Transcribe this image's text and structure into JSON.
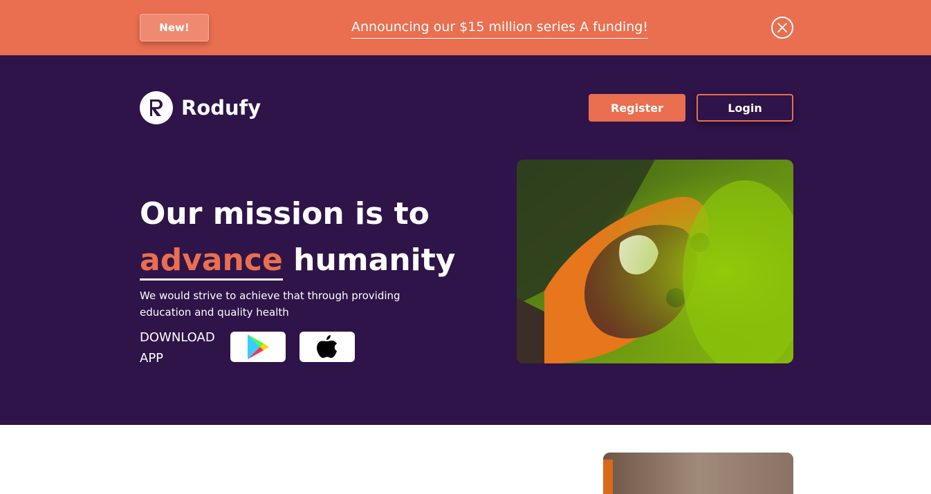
{
  "banner": {
    "badge_label": "New!",
    "announcement": "Announcing our $15 million series A funding!",
    "close_icon": "close-icon"
  },
  "header": {
    "brand_name": "Rodufy",
    "logo_letter": "R",
    "register_label": "Register",
    "login_label": "Login"
  },
  "hero": {
    "headline_line1": "Our mission is to",
    "headline_accent": "advance",
    "headline_rest": " humanity",
    "subtext": "We would strive to achieve that through providing education and quality health",
    "download_label": "DOWNLOAD APP",
    "store_icons": [
      "google-play-icon",
      "apple-icon"
    ]
  },
  "colors": {
    "banner_bg": "#e96f50",
    "hero_bg": "#2e1448",
    "accent": "#e96f50"
  }
}
